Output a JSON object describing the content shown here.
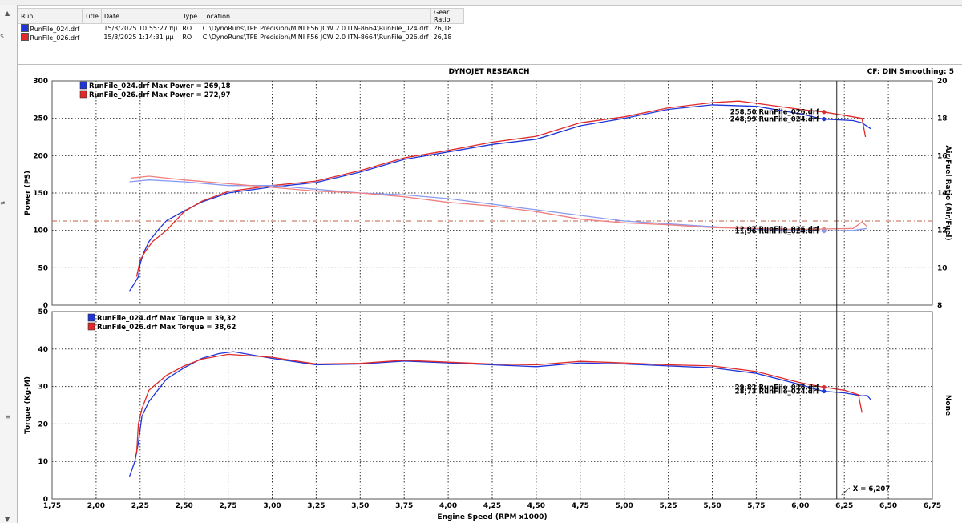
{
  "runs_table": {
    "columns": [
      "Run",
      "Title",
      "Date",
      "Type",
      "Location",
      "Gear Ratio"
    ],
    "rows": [
      {
        "run": "RunFile_024.drf",
        "title": "",
        "date": "15/3/2025 10:55:27 πμ",
        "type": "RO",
        "location": "C:\\DynoRuns\\TPE Precision\\MINI F56 JCW 2.0  ITN-8664\\RunFile_024.drf",
        "gear_ratio": "26,18",
        "color": "#1f35d8"
      },
      {
        "run": "RunFile_026.drf",
        "title": "",
        "date": "15/3/2025 1:14:31 μμ",
        "type": "RO",
        "location": "C:\\DynoRuns\\TPE Precision\\MINI F56 JCW 2.0  ITN-8664\\RunFile_026.drf",
        "gear_ratio": "26,18",
        "color": "#e02a2a"
      }
    ]
  },
  "header": {
    "title": "DYNOJET RESEARCH",
    "info": "CF: DIN  Smoothing: 5"
  },
  "edge_glyphs": [
    "▲",
    "$",
    "≠",
    "≡",
    "▼"
  ],
  "chart_data": [
    {
      "type": "line",
      "panel": "upper",
      "ylabel": "Power (PS)",
      "ylim": [
        0,
        300
      ],
      "yticks": [
        "0",
        "50",
        "100",
        "150",
        "200",
        "250",
        "300"
      ],
      "y2label": "Air/Fuel Ratio (Air/Fuel)",
      "y2lim": [
        8,
        20
      ],
      "y2ticks": [
        "8",
        "10",
        "12",
        "14",
        "16",
        "18",
        "20"
      ],
      "ref_line_afr": 12.5,
      "legend": [
        "RunFile_024.drf Max Power = 269,18",
        "RunFile_026.drf Max Power = 272,97"
      ],
      "cursor_labels": [
        {
          "text": "258,50 RunFile_026.drf",
          "value": 258.5,
          "axis": "left",
          "color": "#e02a2a"
        },
        {
          "text": "248,99 RunFile_024.drf",
          "value": 248.99,
          "axis": "left",
          "color": "#1f35d8"
        },
        {
          "text": "12,07 RunFile_026.drf",
          "value": 12.07,
          "axis": "right",
          "color": "#f08080"
        },
        {
          "text": "11,96 RunFile_024.drf",
          "value": 11.96,
          "axis": "right",
          "color": "#8a9af0"
        }
      ],
      "series": [
        {
          "name": "RunFile_024.drf",
          "quantity": "Power",
          "axis": "left",
          "color": "#1f35d8",
          "points": [
            [
              2.19,
              19
            ],
            [
              2.22,
              30
            ],
            [
              2.24,
              38
            ],
            [
              2.25,
              55
            ],
            [
              2.27,
              70
            ],
            [
              2.3,
              85
            ],
            [
              2.35,
              100
            ],
            [
              2.4,
              113
            ],
            [
              2.5,
              126
            ],
            [
              2.6,
              138
            ],
            [
              2.75,
              150
            ],
            [
              3.0,
              158
            ],
            [
              3.25,
              164
            ],
            [
              3.5,
              178
            ],
            [
              3.75,
              195
            ],
            [
              4.0,
              205
            ],
            [
              4.25,
              215
            ],
            [
              4.5,
              222
            ],
            [
              4.75,
              240
            ],
            [
              5.0,
              250
            ],
            [
              5.25,
              262
            ],
            [
              5.5,
              268
            ],
            [
              5.75,
              266
            ],
            [
              6.0,
              256
            ],
            [
              6.13,
              249
            ],
            [
              6.3,
              247
            ],
            [
              6.35,
              244
            ],
            [
              6.4,
              236
            ]
          ]
        },
        {
          "name": "RunFile_026.drf",
          "quantity": "Power",
          "axis": "left",
          "color": "#e02a2a",
          "points": [
            [
              2.23,
              38
            ],
            [
              2.25,
              60
            ],
            [
              2.28,
              72
            ],
            [
              2.32,
              85
            ],
            [
              2.4,
              100
            ],
            [
              2.5,
              125
            ],
            [
              2.6,
              139
            ],
            [
              2.75,
              152
            ],
            [
              3.0,
              160
            ],
            [
              3.25,
              166
            ],
            [
              3.5,
              180
            ],
            [
              3.75,
              197
            ],
            [
              4.0,
              207
            ],
            [
              4.25,
              218
            ],
            [
              4.5,
              226
            ],
            [
              4.75,
              244
            ],
            [
              5.0,
              252
            ],
            [
              5.25,
              264
            ],
            [
              5.5,
              271
            ],
            [
              5.65,
              273
            ],
            [
              5.75,
              270
            ],
            [
              6.0,
              262
            ],
            [
              6.13,
              258.5
            ],
            [
              6.3,
              252
            ],
            [
              6.35,
              250
            ],
            [
              6.37,
              225
            ]
          ]
        },
        {
          "name": "RunFile_024.drf",
          "quantity": "Air/Fuel",
          "axis": "right",
          "color": "#8a9af0",
          "points": [
            [
              2.19,
              14.6
            ],
            [
              2.3,
              14.7
            ],
            [
              2.5,
              14.6
            ],
            [
              2.75,
              14.4
            ],
            [
              3.0,
              14.4
            ],
            [
              3.25,
              14.2
            ],
            [
              3.5,
              14.0
            ],
            [
              3.75,
              13.9
            ],
            [
              4.0,
              13.7
            ],
            [
              4.25,
              13.4
            ],
            [
              4.5,
              13.1
            ],
            [
              4.75,
              12.8
            ],
            [
              5.0,
              12.5
            ],
            [
              5.25,
              12.35
            ],
            [
              5.5,
              12.2
            ],
            [
              5.75,
              12.05
            ],
            [
              6.0,
              12.0
            ],
            [
              6.13,
              11.96
            ],
            [
              6.3,
              12.0
            ],
            [
              6.38,
              12.1
            ]
          ]
        },
        {
          "name": "RunFile_026.drf",
          "quantity": "Air/Fuel",
          "axis": "right",
          "color": "#f08080",
          "points": [
            [
              2.2,
              14.8
            ],
            [
              2.3,
              14.9
            ],
            [
              2.5,
              14.7
            ],
            [
              2.75,
              14.5
            ],
            [
              3.0,
              14.3
            ],
            [
              3.25,
              14.1
            ],
            [
              3.5,
              14.0
            ],
            [
              3.75,
              13.8
            ],
            [
              4.0,
              13.5
            ],
            [
              4.25,
              13.3
            ],
            [
              4.5,
              13.0
            ],
            [
              4.75,
              12.6
            ],
            [
              5.0,
              12.4
            ],
            [
              5.25,
              12.3
            ],
            [
              5.5,
              12.15
            ],
            [
              5.75,
              12.1
            ],
            [
              6.0,
              12.05
            ],
            [
              6.13,
              12.07
            ],
            [
              6.3,
              12.1
            ],
            [
              6.35,
              12.45
            ],
            [
              6.38,
              12.2
            ]
          ]
        }
      ]
    },
    {
      "type": "line",
      "panel": "lower",
      "xlabel": "Engine Speed (RPM x1000)",
      "xlim": [
        1.75,
        6.75
      ],
      "xticks": [
        "1,75",
        "2,00",
        "2,25",
        "2,50",
        "2,75",
        "3,00",
        "3,25",
        "3,50",
        "3,75",
        "4,00",
        "4,25",
        "4,50",
        "4,75",
        "5,00",
        "5,25",
        "5,50",
        "5,75",
        "6,00",
        "6,25",
        "6,50",
        "6,75"
      ],
      "ylabel": "Torque (Kg-M)",
      "ylim": [
        0,
        50
      ],
      "yticks": [
        "0",
        "10",
        "20",
        "30",
        "40",
        "50"
      ],
      "y2label": "None",
      "cursor_x": 6.207,
      "cursor_x_label": "X = 6,207",
      "legend": [
        "RunFile_024.drf Max Torque = 39,32",
        "RunFile_026.drf Max Torque = 38,62"
      ],
      "cursor_labels": [
        {
          "text": "29,82 RunFile_026.drf",
          "value": 29.82,
          "color": "#e02a2a"
        },
        {
          "text": "28,73 RunFile_024.drf",
          "value": 28.73,
          "color": "#1f35d8"
        }
      ],
      "series": [
        {
          "name": "RunFile_024.drf",
          "quantity": "Torque",
          "color": "#1f35d8",
          "points": [
            [
              2.19,
              6
            ],
            [
              2.22,
              10
            ],
            [
              2.24,
              15
            ],
            [
              2.26,
              22
            ],
            [
              2.3,
              26
            ],
            [
              2.4,
              32
            ],
            [
              2.5,
              35
            ],
            [
              2.6,
              37.5
            ],
            [
              2.7,
              38.8
            ],
            [
              2.78,
              39.3
            ],
            [
              3.0,
              37.5
            ],
            [
              3.25,
              35.8
            ],
            [
              3.5,
              36
            ],
            [
              3.75,
              36.8
            ],
            [
              4.0,
              36.3
            ],
            [
              4.25,
              35.8
            ],
            [
              4.5,
              35.3
            ],
            [
              4.75,
              36.3
            ],
            [
              5.0,
              36
            ],
            [
              5.25,
              35.5
            ],
            [
              5.5,
              35
            ],
            [
              5.75,
              33.5
            ],
            [
              6.0,
              30.5
            ],
            [
              6.13,
              28.73
            ],
            [
              6.25,
              28.3
            ],
            [
              6.35,
              27.5
            ],
            [
              6.38,
              27.6
            ],
            [
              6.4,
              26.5
            ]
          ]
        },
        {
          "name": "RunFile_026.drf",
          "quantity": "Torque",
          "color": "#e02a2a",
          "points": [
            [
              2.23,
              12
            ],
            [
              2.24,
              20
            ],
            [
              2.26,
              24
            ],
            [
              2.3,
              29
            ],
            [
              2.4,
              33
            ],
            [
              2.5,
              35.5
            ],
            [
              2.6,
              37.3
            ],
            [
              2.75,
              38.6
            ],
            [
              3.0,
              37.8
            ],
            [
              3.25,
              36
            ],
            [
              3.5,
              36.2
            ],
            [
              3.75,
              37
            ],
            [
              4.0,
              36.5
            ],
            [
              4.25,
              36
            ],
            [
              4.5,
              35.8
            ],
            [
              4.75,
              36.7
            ],
            [
              5.0,
              36.3
            ],
            [
              5.25,
              35.8
            ],
            [
              5.5,
              35.5
            ],
            [
              5.75,
              34
            ],
            [
              6.0,
              31
            ],
            [
              6.13,
              29.82
            ],
            [
              6.25,
              29
            ],
            [
              6.33,
              27.8
            ],
            [
              6.35,
              23
            ]
          ]
        }
      ]
    }
  ]
}
